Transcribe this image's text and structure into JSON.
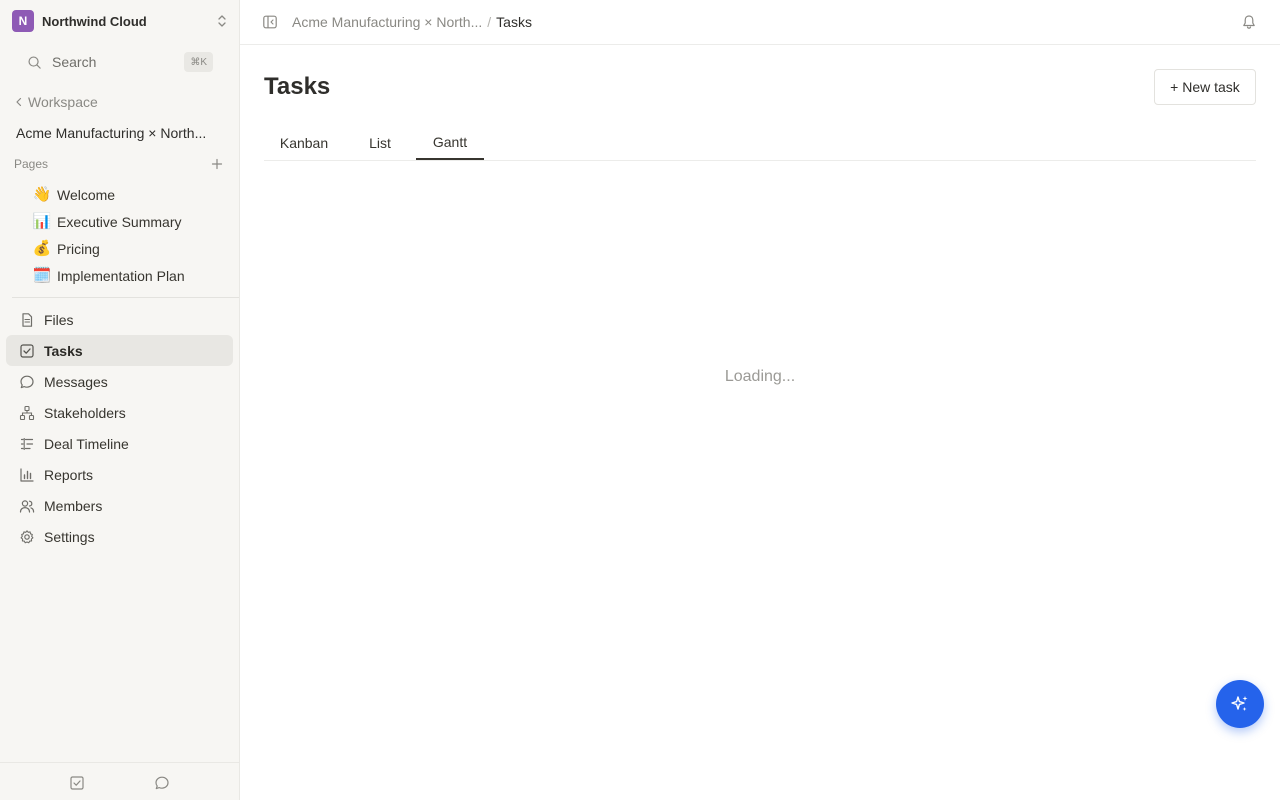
{
  "workspace": {
    "badge": "N",
    "name": "Northwind Cloud"
  },
  "search": {
    "label": "Search",
    "shortcut": "⌘K"
  },
  "sidebar": {
    "back_label": "Workspace",
    "project_title": "Acme Manufacturing × North...",
    "pages_label": "Pages",
    "pages": [
      {
        "emoji": "👋",
        "label": "Welcome"
      },
      {
        "emoji": "📊",
        "label": "Executive Summary"
      },
      {
        "emoji": "💰",
        "label": "Pricing"
      },
      {
        "emoji": "🗓️",
        "label": "Implementation Plan"
      }
    ],
    "nav": [
      {
        "icon": "file-icon",
        "label": "Files"
      },
      {
        "icon": "checkbox-icon",
        "label": "Tasks",
        "active": true
      },
      {
        "icon": "chat-bubble-icon",
        "label": "Messages"
      },
      {
        "icon": "org-chart-icon",
        "label": "Stakeholders"
      },
      {
        "icon": "timeline-icon",
        "label": "Deal Timeline"
      },
      {
        "icon": "bar-chart-icon",
        "label": "Reports"
      },
      {
        "icon": "people-icon",
        "label": "Members"
      },
      {
        "icon": "gear-icon",
        "label": "Settings"
      }
    ]
  },
  "breadcrumb": {
    "parent": "Acme Manufacturing × North...",
    "separator": "/",
    "current": "Tasks"
  },
  "main": {
    "title": "Tasks",
    "new_task_label": "+ New task",
    "tabs": [
      {
        "label": "Kanban"
      },
      {
        "label": "List"
      },
      {
        "label": "Gantt",
        "active": true
      }
    ],
    "loading_text": "Loading..."
  },
  "colors": {
    "accent": "#2563eb",
    "workspace_badge": "#8e5ab5",
    "sidebar_bg": "#f7f6f3",
    "active_nav_bg": "#e8e7e3"
  }
}
